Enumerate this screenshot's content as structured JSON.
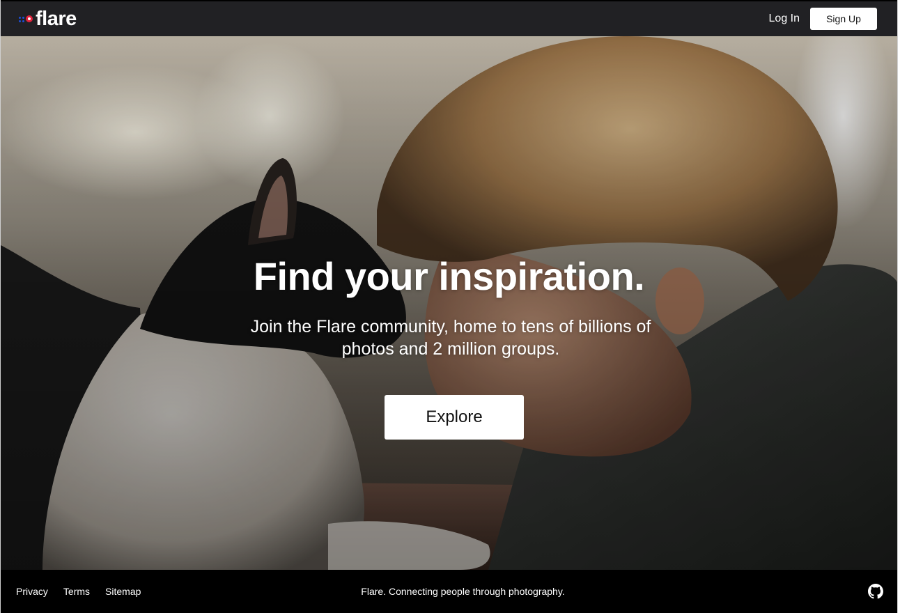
{
  "brand": {
    "name": "flare",
    "logo_dot_colors": [
      "#1e4fd6",
      "#1e4fd6",
      "#e2223c",
      "#e2223c",
      "#ffffff"
    ]
  },
  "header": {
    "login_label": "Log In",
    "signup_label": "Sign Up"
  },
  "hero": {
    "title": "Find your inspiration.",
    "subtitle": "Join the Flare community, home to tens of billions of photos and 2 million groups.",
    "cta_label": "Explore",
    "background_description_icon": "hero-photo"
  },
  "footer": {
    "links": [
      "Privacy",
      "Terms",
      "Sitemap"
    ],
    "tagline": "Flare. Connecting people through photography.",
    "social_icon": "github-icon"
  },
  "colors": {
    "header_bg": "#212124",
    "footer_bg": "#000000",
    "button_bg": "#ffffff",
    "text_light": "#ffffff"
  }
}
